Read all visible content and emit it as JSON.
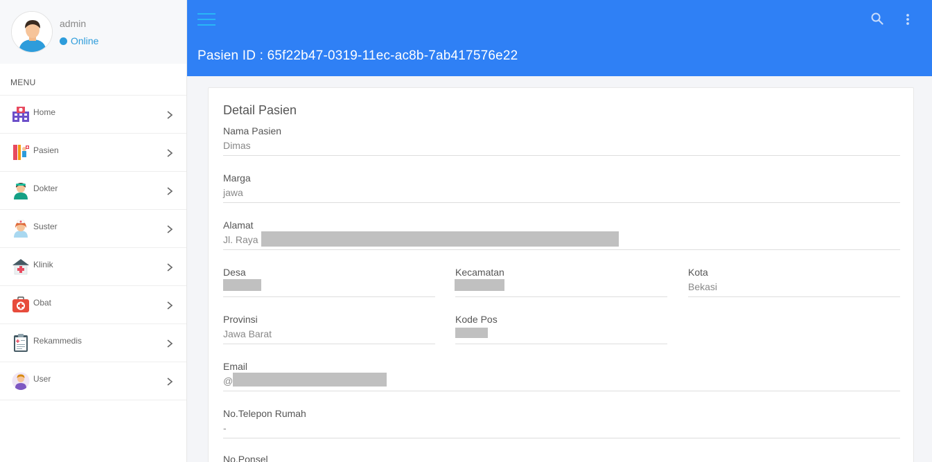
{
  "user": {
    "name": "admin",
    "status": "Online"
  },
  "sidebar": {
    "menu_header": "MENU",
    "items": [
      {
        "label": "Home",
        "icon": "hospital-icon"
      },
      {
        "label": "Pasien",
        "icon": "patient-icon"
      },
      {
        "label": "Dokter",
        "icon": "doctor-icon"
      },
      {
        "label": "Suster",
        "icon": "nurse-icon"
      },
      {
        "label": "Klinik",
        "icon": "clinic-icon"
      },
      {
        "label": "Obat",
        "icon": "medicine-kit-icon"
      },
      {
        "label": "Rekammedis",
        "icon": "clipboard-icon"
      },
      {
        "label": "User",
        "icon": "user-icon"
      }
    ]
  },
  "header": {
    "title": "Pasien ID : 65f22b47-0319-11ec-ac8b-7ab417576e22"
  },
  "card": {
    "title": "Detail Pasien",
    "fields": {
      "nama": {
        "label": "Nama Pasien",
        "value": "Dimas"
      },
      "marga": {
        "label": "Marga",
        "value": "jawa"
      },
      "alamat": {
        "label": "Alamat",
        "value": "Jl. Raya"
      },
      "desa": {
        "label": "Desa",
        "value": ""
      },
      "kecamatan": {
        "label": "Kecamatan",
        "value": ""
      },
      "kota": {
        "label": "Kota",
        "value": "Bekasi"
      },
      "provinsi": {
        "label": "Provinsi",
        "value": "Jawa Barat"
      },
      "kodepos": {
        "label": "Kode Pos",
        "value": ""
      },
      "email": {
        "label": "Email",
        "value": "@"
      },
      "telepon": {
        "label": "No.Telepon Rumah",
        "value": "-"
      },
      "ponsel": {
        "label": "No.Ponsel",
        "value": ""
      }
    }
  },
  "colors": {
    "header": "#2f80f5",
    "accent": "#2d9cdb",
    "redaction": "#c0c0c0"
  }
}
